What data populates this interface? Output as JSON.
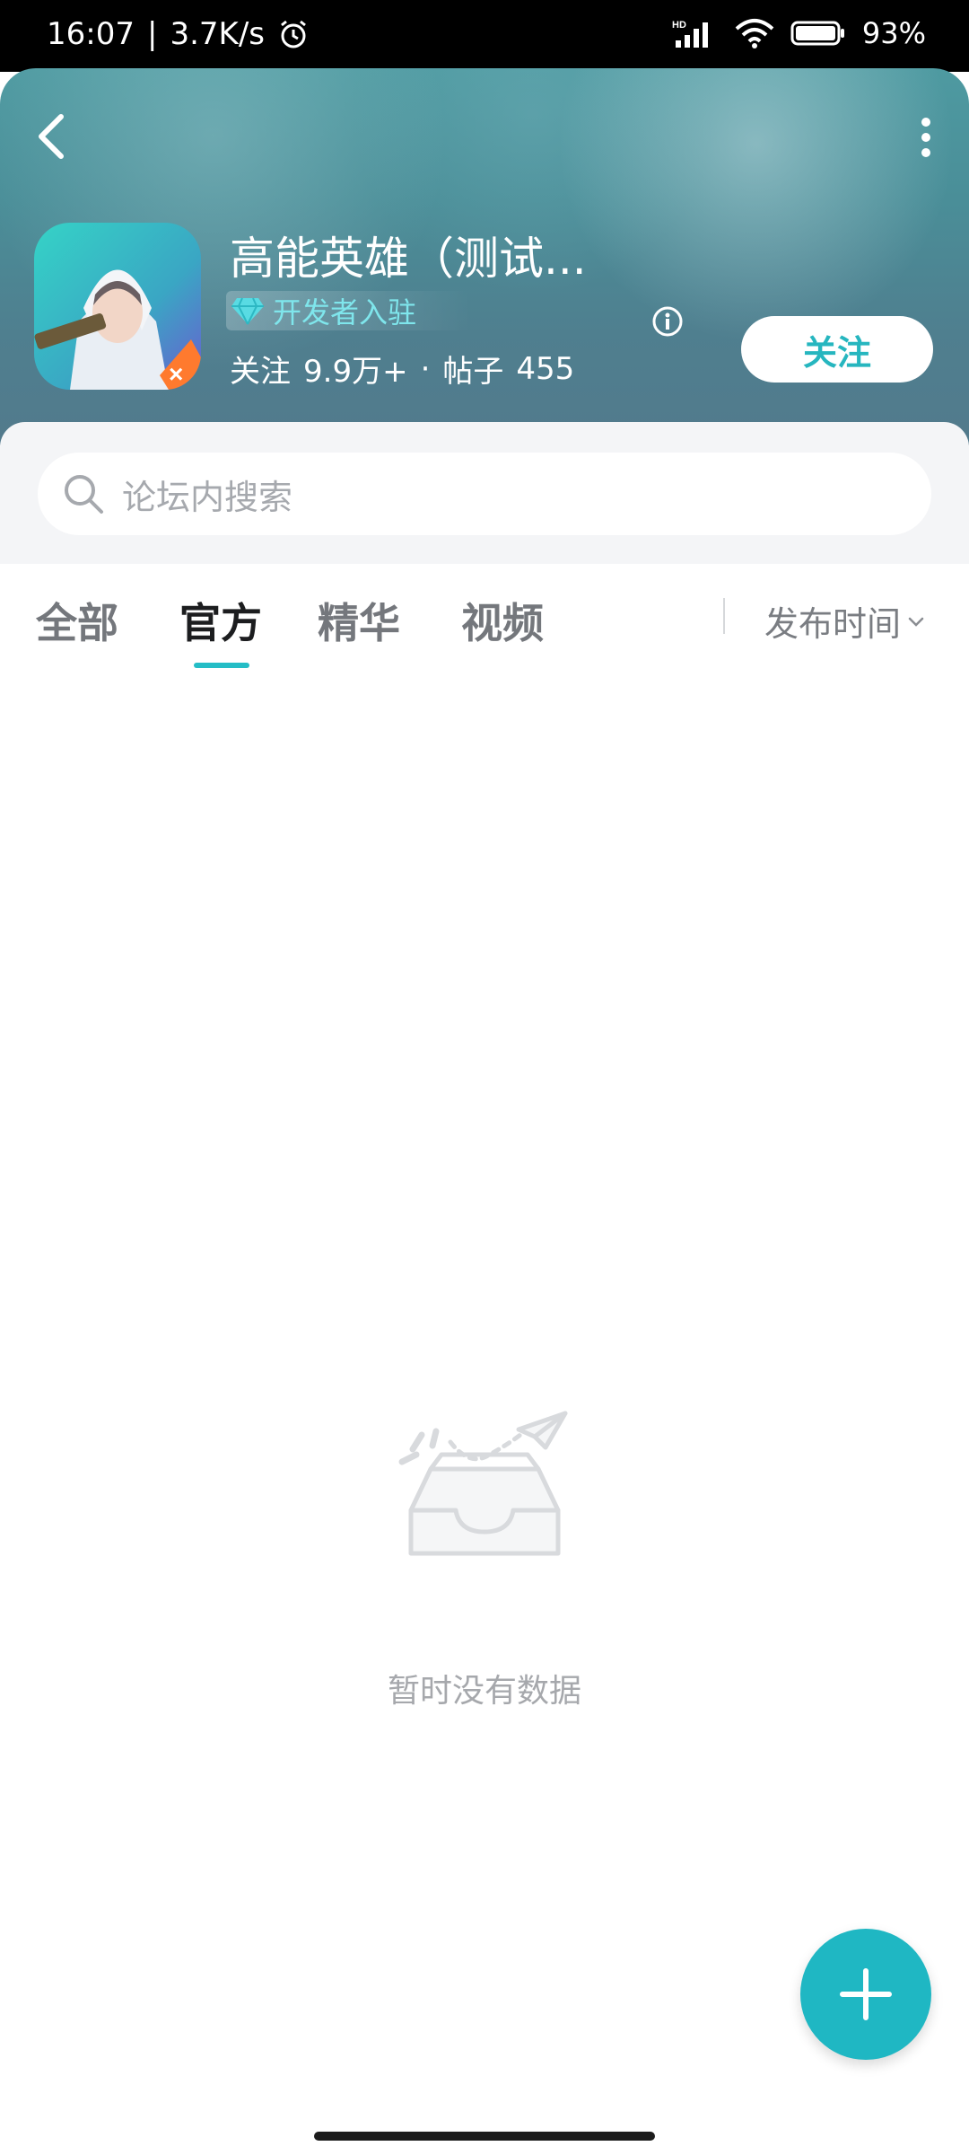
{
  "status_bar": {
    "time": "16:07",
    "speed": "3.7K/s",
    "battery": "93%",
    "icons": [
      "alarm-icon",
      "hd-signal-icon",
      "wifi-icon",
      "battery-icon"
    ]
  },
  "header": {
    "title": "高能英雄（测试...",
    "developer_badge": "开发者入驻",
    "followers_label": "关注",
    "followers_value": "9.9万+",
    "separator": "·",
    "posts_label": "帖子",
    "posts_value": "455",
    "follow_button": "关注"
  },
  "search": {
    "placeholder": "论坛内搜索"
  },
  "tabs": {
    "items": [
      {
        "label": "全部",
        "active": false
      },
      {
        "label": "官方",
        "active": true
      },
      {
        "label": "精华",
        "active": false
      },
      {
        "label": "视频",
        "active": false
      }
    ],
    "sort_label": "发布时间"
  },
  "empty_state": {
    "text": "暂时没有数据"
  },
  "colors": {
    "accent": "#24bdc6",
    "header_bg": "#4f8f98",
    "fab": "#1fb7c3"
  }
}
